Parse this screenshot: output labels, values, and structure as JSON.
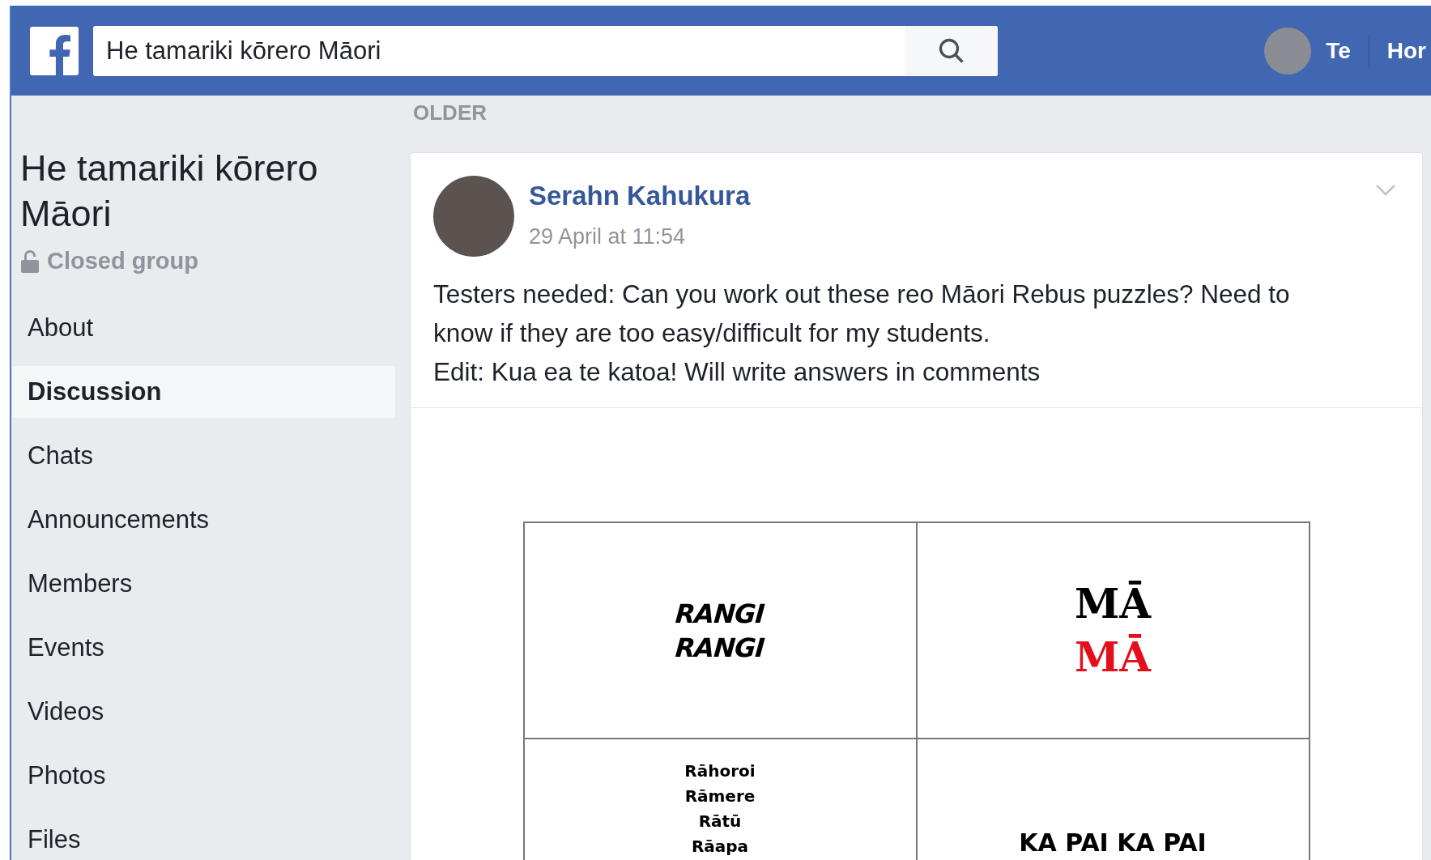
{
  "top_bar": {
    "search": {
      "value": "He tamariki kōrero Māori"
    },
    "profile_name": "Te",
    "nav_link": "Hor"
  },
  "sidebar": {
    "group_title": "He tamariki kōrero Māori",
    "privacy": "Closed group",
    "items": [
      {
        "label": "About",
        "selected": false
      },
      {
        "label": "Discussion",
        "selected": true
      },
      {
        "label": "Chats",
        "selected": false
      },
      {
        "label": "Announcements",
        "selected": false
      },
      {
        "label": "Members",
        "selected": false
      },
      {
        "label": "Events",
        "selected": false
      },
      {
        "label": "Videos",
        "selected": false
      },
      {
        "label": "Photos",
        "selected": false
      },
      {
        "label": "Files",
        "selected": false
      }
    ]
  },
  "feed": {
    "section_label": "OLDER",
    "post": {
      "author": "Serahn Kahukura",
      "time": "29 April at 11:54",
      "paragraphs": [
        "Testers needed: Can you work out these reo Māori Rebus puzzles? Need to know if they are too easy/difficult for my students.",
        "Edit: Kua ea te katoa! Will write answers in comments"
      ],
      "puzzle_cells": [
        {
          "kind": "script",
          "lines": [
            {
              "text": "RANGI",
              "color": "#000000"
            },
            {
              "text": "RANGI",
              "color": "#000000"
            }
          ]
        },
        {
          "kind": "serif",
          "lines": [
            {
              "text": "MĀ",
              "color": "#000000"
            },
            {
              "text": "MĀ",
              "color": "#e3101b"
            }
          ]
        },
        {
          "kind": "list",
          "lines": [
            {
              "text": "Rāhoroi",
              "color": "#000000"
            },
            {
              "text": "Rāmere",
              "color": "#000000"
            },
            {
              "text": "Rātū",
              "color": "#000000"
            },
            {
              "text": "Rāapa",
              "color": "#000000"
            }
          ]
        },
        {
          "kind": "caption",
          "lines": [
            {
              "text": "KA PAI KA PAI",
              "color": "#000000"
            }
          ]
        }
      ]
    }
  }
}
